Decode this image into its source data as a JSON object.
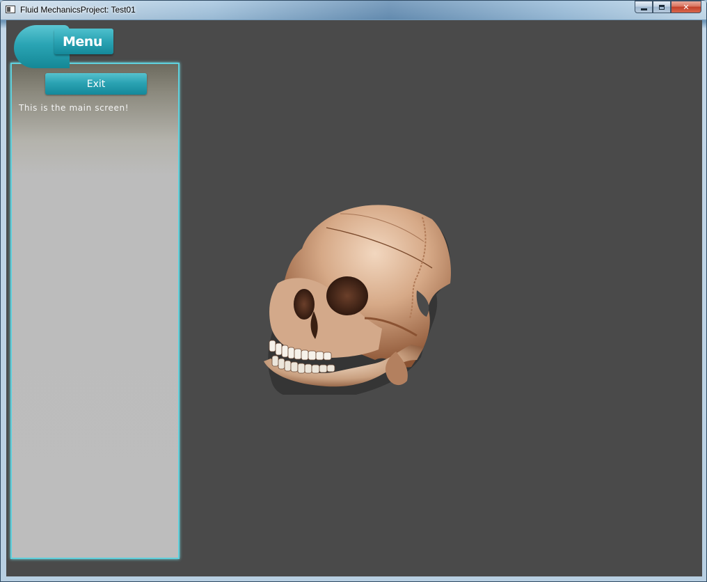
{
  "window": {
    "title": "Fluid MechanicsProject: Test01",
    "minimize_icon": "minimize-icon",
    "maximize_icon": "maximize-icon",
    "close_glyph": "✕"
  },
  "menu": {
    "label": "Menu"
  },
  "panel": {
    "exit_label": "Exit",
    "message": "This is the main screen!"
  },
  "viewport": {
    "icon": "skull-render",
    "colors": {
      "background": "#4a4a4a",
      "bone": "#d9b494",
      "shadow": "#7a4a2c"
    }
  }
}
